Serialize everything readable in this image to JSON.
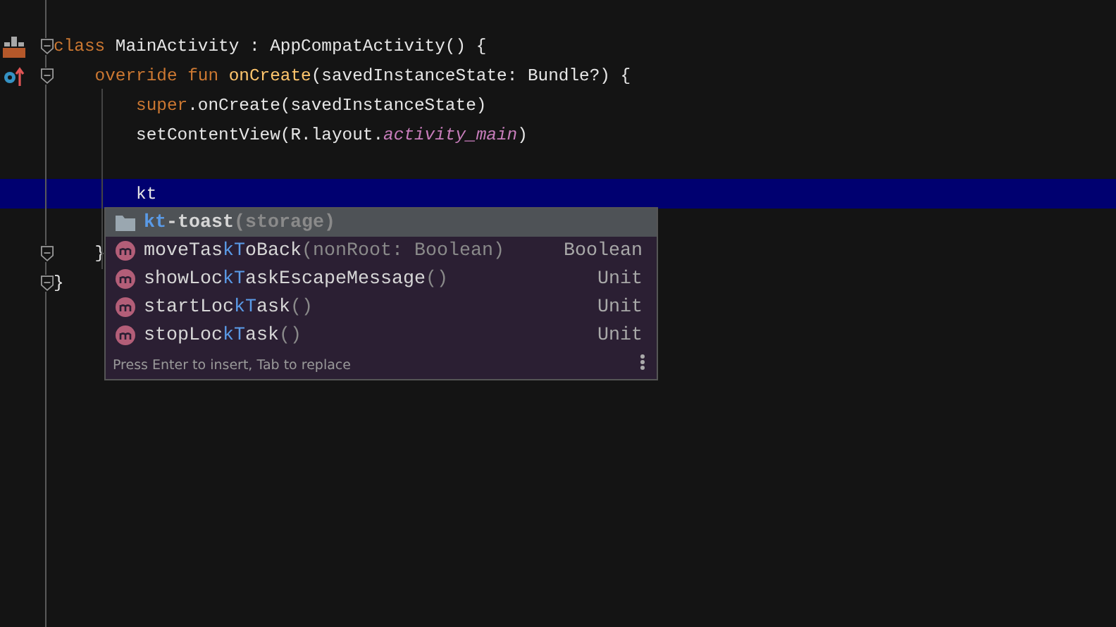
{
  "editor": {
    "lines": [
      {
        "gutter": {
          "kind": "class"
        },
        "fold": true,
        "current": false,
        "tokens": [
          {
            "text": "class",
            "kind": "keyword"
          },
          {
            "text": " MainActivity : AppCompatActivity() {",
            "kind": "plain"
          }
        ]
      },
      {
        "gutter": {
          "kind": "override"
        },
        "fold": true,
        "current": false,
        "tokens": [
          {
            "text": "    override fun",
            "kind": "keyword"
          },
          {
            "text": " onCreate",
            "kind": "function"
          },
          {
            "text": "(savedInstanceState: Bundle?) {",
            "kind": "plain"
          }
        ]
      },
      {
        "current": false,
        "tokens": [
          {
            "text": "        super",
            "kind": "keyword"
          },
          {
            "text": ".onCreate(savedInstanceState)",
            "kind": "plain"
          }
        ]
      },
      {
        "current": false,
        "tokens": [
          {
            "text": "        setContentView(R.layout.",
            "kind": "plain"
          },
          {
            "text": "activity_main",
            "kind": "field"
          },
          {
            "text": ")",
            "kind": "plain"
          }
        ]
      },
      {
        "current": false
      },
      {
        "current": true,
        "tokens": [
          {
            "text": "        kt",
            "kind": "plain"
          }
        ]
      },
      {
        "current": false
      },
      {
        "fold": true,
        "current": false,
        "tokens": [
          {
            "text": "    }",
            "kind": "plain"
          }
        ]
      },
      {
        "fold": true,
        "current": false,
        "tokens": [
          {
            "text": "}",
            "kind": "plain"
          }
        ]
      }
    ]
  },
  "completion": {
    "items": [
      {
        "kind": "folder",
        "selected": true,
        "parts": [
          {
            "text": "kt",
            "match": true
          },
          {
            "text": "-toast",
            "match": false
          }
        ],
        "detail": "(storage)"
      },
      {
        "kind": "method",
        "selected": false,
        "parts": [
          {
            "text": "moveTas",
            "match": false
          },
          {
            "text": "kT",
            "match": true
          },
          {
            "text": "oBack",
            "match": false
          }
        ],
        "detail": "(nonRoot: Boolean)",
        "type": "Boolean"
      },
      {
        "kind": "method",
        "selected": false,
        "parts": [
          {
            "text": "showLoc",
            "match": false
          },
          {
            "text": "kT",
            "match": true
          },
          {
            "text": "askEscapeMessage",
            "match": false
          }
        ],
        "detail": "()",
        "type": "Unit"
      },
      {
        "kind": "method",
        "selected": false,
        "parts": [
          {
            "text": "startLoc",
            "match": false
          },
          {
            "text": "kT",
            "match": true
          },
          {
            "text": "ask",
            "match": false
          }
        ],
        "detail": "()",
        "type": "Unit"
      },
      {
        "kind": "method",
        "selected": false,
        "parts": [
          {
            "text": "stopLoc",
            "match": false
          },
          {
            "text": "kT",
            "match": true
          },
          {
            "text": "ask",
            "match": false
          }
        ],
        "detail": "()",
        "type": "Unit"
      }
    ],
    "hint": "Press Enter to insert, Tab to replace"
  }
}
